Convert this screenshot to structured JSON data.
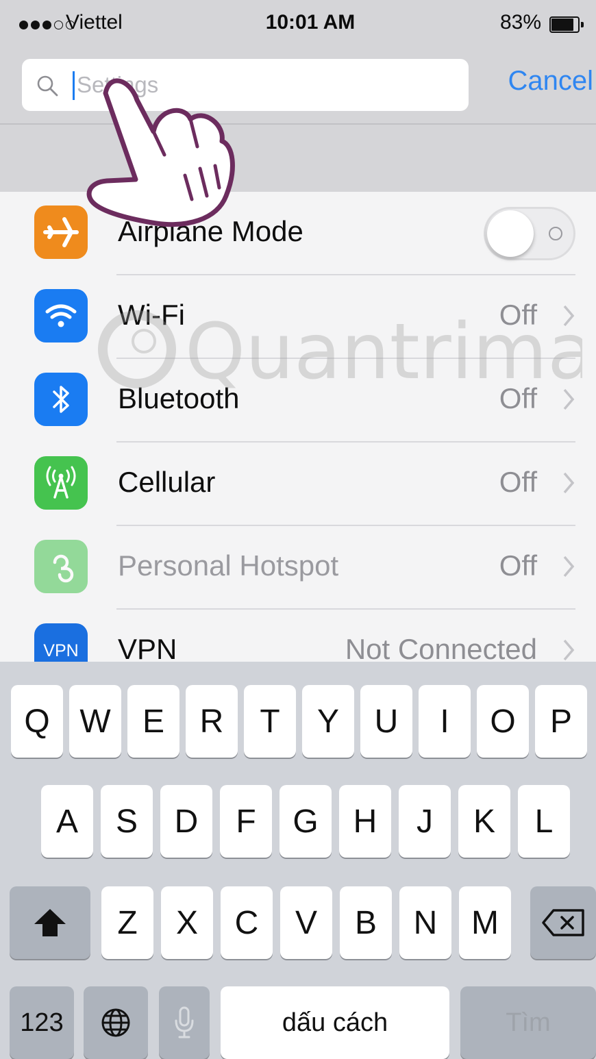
{
  "status_bar": {
    "carrier": "Viettel",
    "time": "10:01 AM",
    "battery_percent": "83%",
    "battery_level": 0.83,
    "signal_bars": 3,
    "signal_max": 5
  },
  "search": {
    "placeholder": "Settings",
    "value": "",
    "cancel_label": "Cancel"
  },
  "settings_rows": [
    {
      "label": "Airplane Mode",
      "icon": "airplane-icon",
      "icon_color": "#ef8b1d",
      "toggle_on": false
    },
    {
      "label": "Wi-Fi",
      "value": "Off",
      "icon": "wifi-icon",
      "icon_color": "#1a7cf2"
    },
    {
      "label": "Bluetooth",
      "value": "Off",
      "icon": "bluetooth-icon",
      "icon_color": "#1a7cf2"
    },
    {
      "label": "Cellular",
      "value": "Off",
      "icon": "cellular-antenna-icon",
      "icon_color": "#45c34f"
    },
    {
      "label": "Personal Hotspot",
      "value": "Off",
      "icon": "hotspot-icon",
      "icon_color": "#45c34f",
      "disabled": true
    },
    {
      "label": "VPN",
      "value": "Not Connected",
      "icon": "vpn-icon",
      "icon_color": "#1a6fe0",
      "icon_text": "VPN"
    }
  ],
  "keyboard": {
    "row1": [
      "Q",
      "W",
      "E",
      "R",
      "T",
      "Y",
      "U",
      "I",
      "O",
      "P"
    ],
    "row2": [
      "A",
      "S",
      "D",
      "F",
      "G",
      "H",
      "J",
      "K",
      "L"
    ],
    "row3": [
      "Z",
      "X",
      "C",
      "V",
      "B",
      "N",
      "M"
    ],
    "numbers_label": "123",
    "space_label": "dấu cách",
    "return_label": "Tìm",
    "icons": {
      "shift": "shift-arrow-icon",
      "delete": "backspace-icon",
      "globe": "globe-icon",
      "mic": "microphone-icon"
    }
  },
  "watermark": {
    "text": "Quantrimang"
  },
  "colors": {
    "accent": "#2f86f1",
    "list_bg": "#f4f4f5",
    "header_bg": "#d5d5d8",
    "keyboard_bg": "#d0d3d9"
  }
}
